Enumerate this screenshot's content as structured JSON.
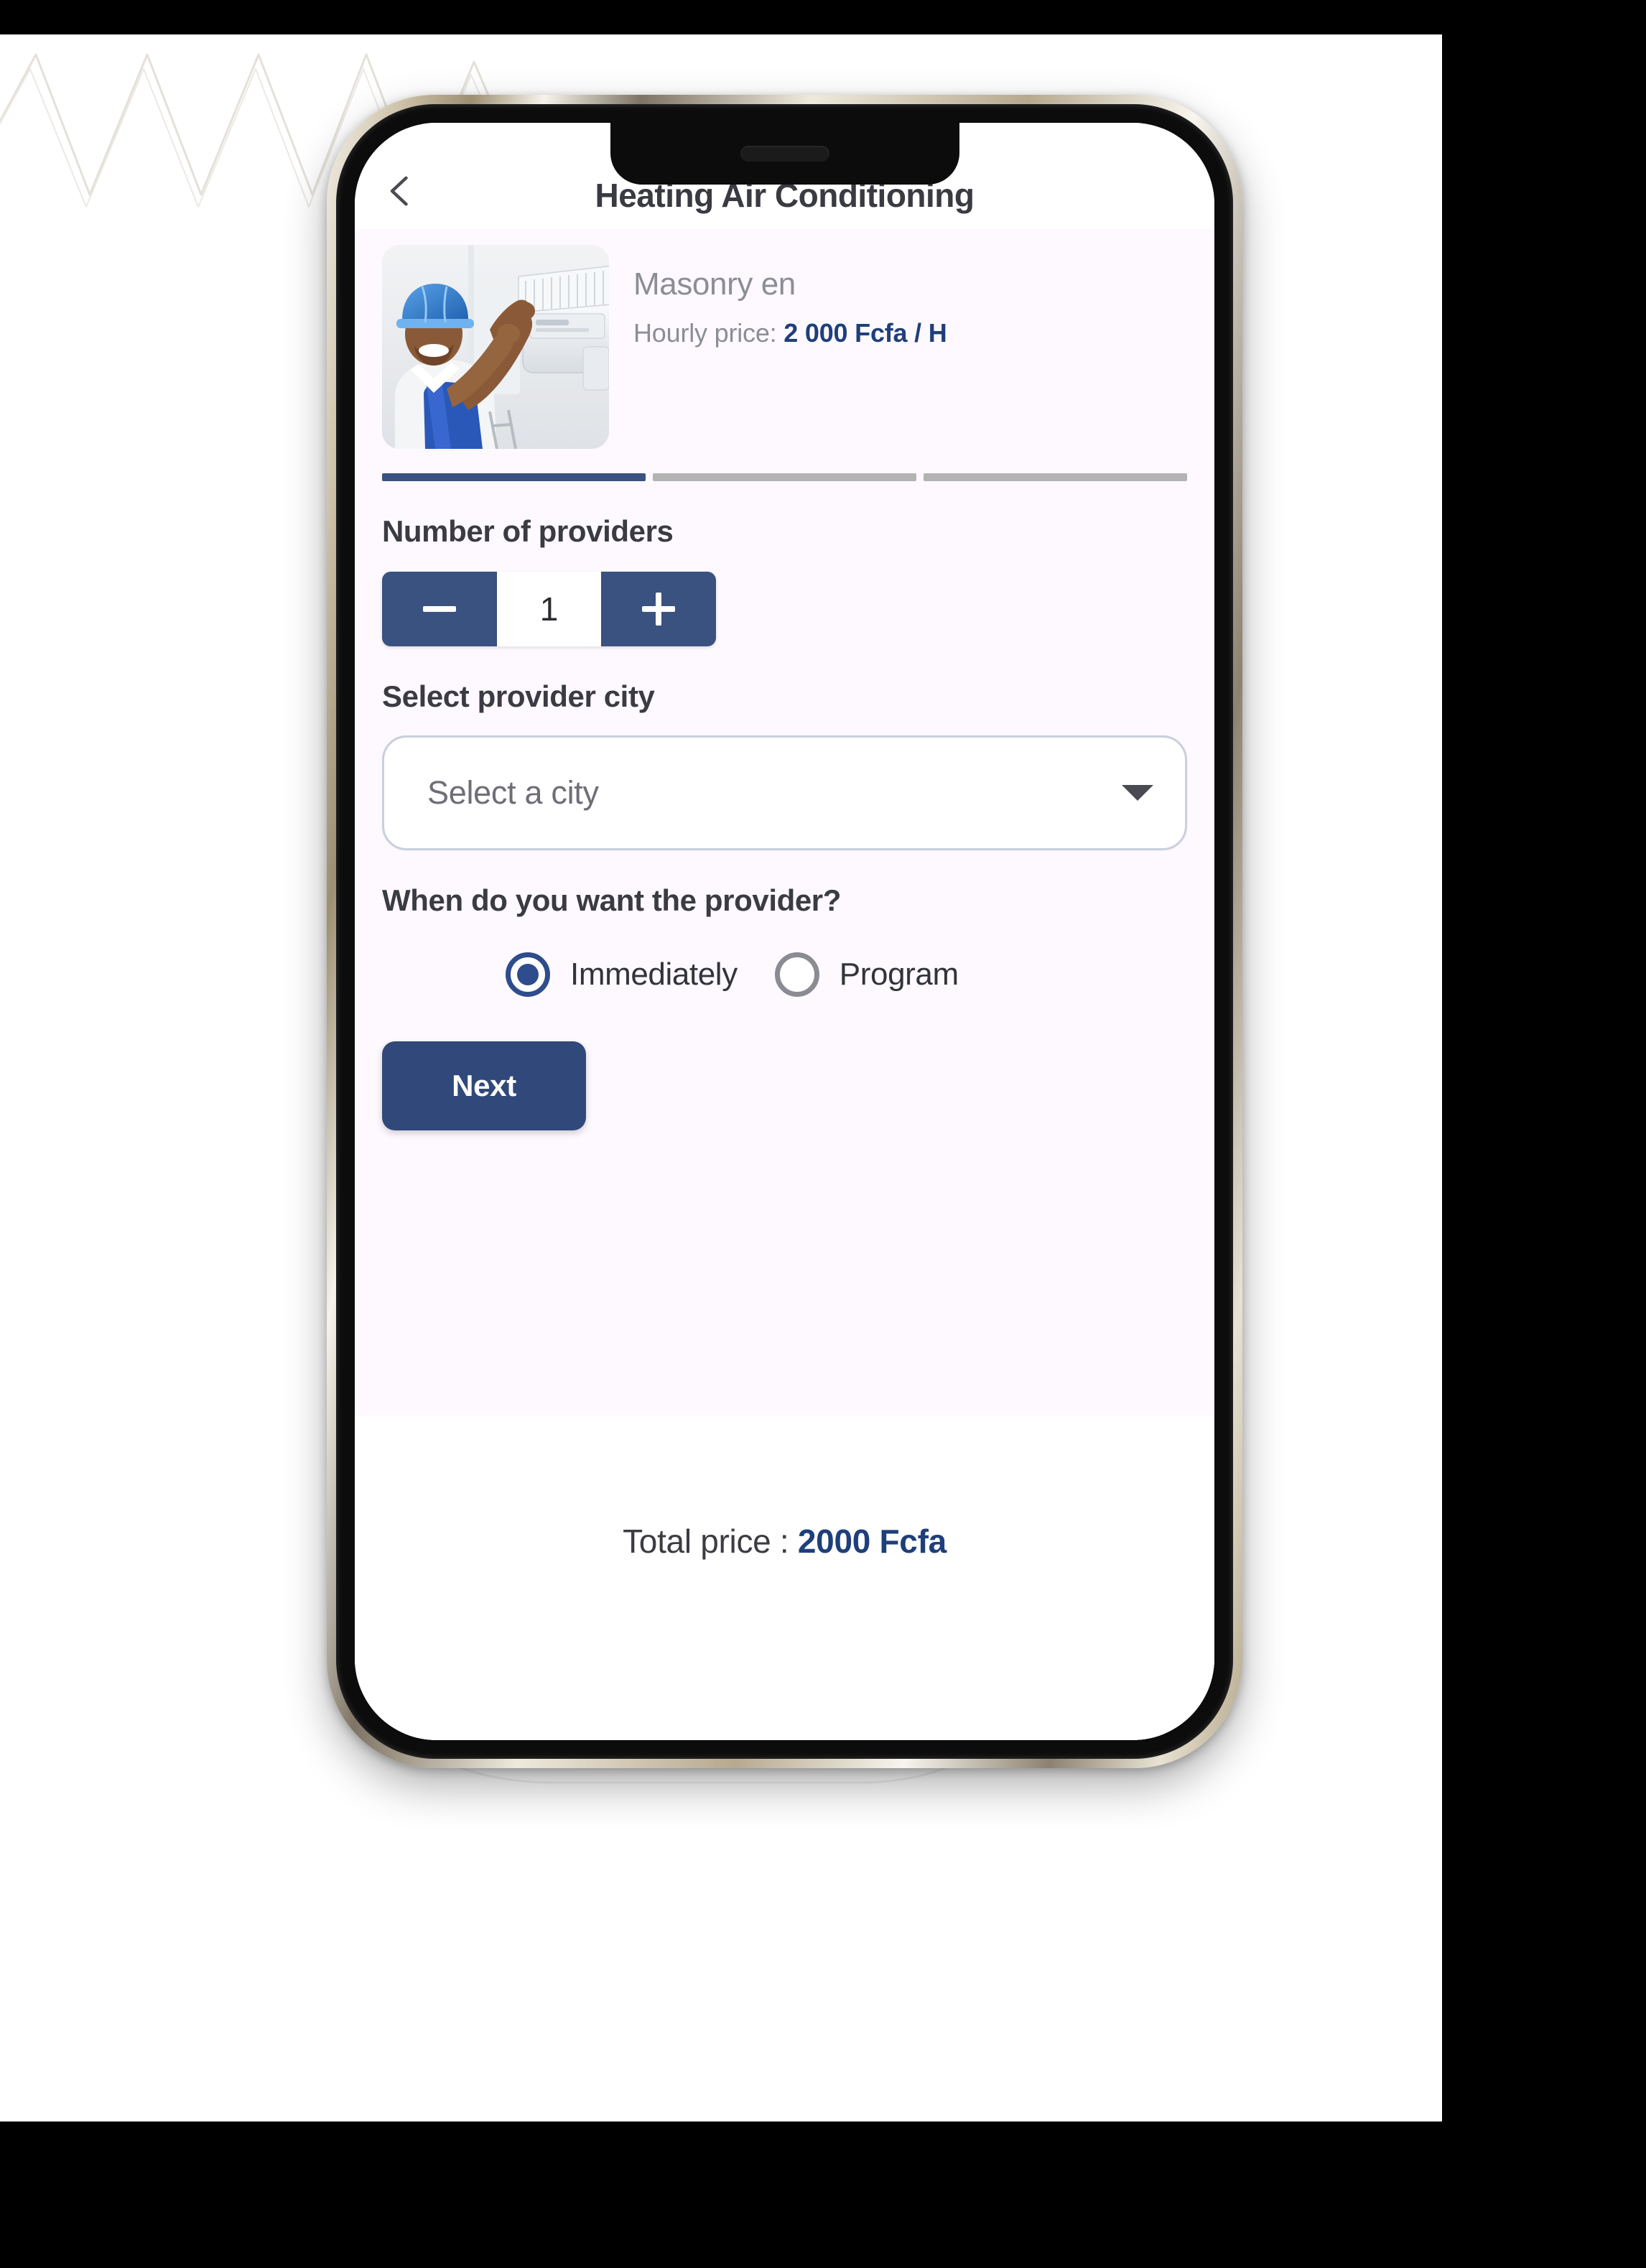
{
  "appbar": {
    "back_icon": "chevron-left-icon",
    "title": "Heating Air Conditioning"
  },
  "service_card": {
    "image_alt": "hvac-technician-installing-air-conditioner",
    "name": "Masonry en",
    "price_label": "Hourly price: ",
    "price_value": "2 000 Fcfa / H"
  },
  "progress": {
    "total_steps": 3,
    "current_step": 1
  },
  "providers": {
    "label": "Number of providers",
    "decrement_icon": "minus-icon",
    "increment_icon": "plus-icon",
    "value": "1"
  },
  "city": {
    "label": "Select provider city",
    "placeholder": "Select a city",
    "value": "",
    "caret_icon": "chevron-down-icon",
    "options": [
      "Select a city"
    ]
  },
  "timing": {
    "question": "When do you want the provider?",
    "options": [
      {
        "label": "Immediately",
        "selected": true
      },
      {
        "label": "Program",
        "selected": false
      }
    ]
  },
  "next_button": {
    "label": "Next"
  },
  "footer": {
    "total_label": "Total price : ",
    "total_value": "2000 Fcfa"
  },
  "colors": {
    "primary_navy": "#3a527f",
    "button_navy": "#31497a",
    "accent_blue": "#1f3f7a",
    "screen_bg": "#fdf9ff",
    "muted_text": "#8d8d96",
    "progress_inactive": "#b3b3b3"
  }
}
